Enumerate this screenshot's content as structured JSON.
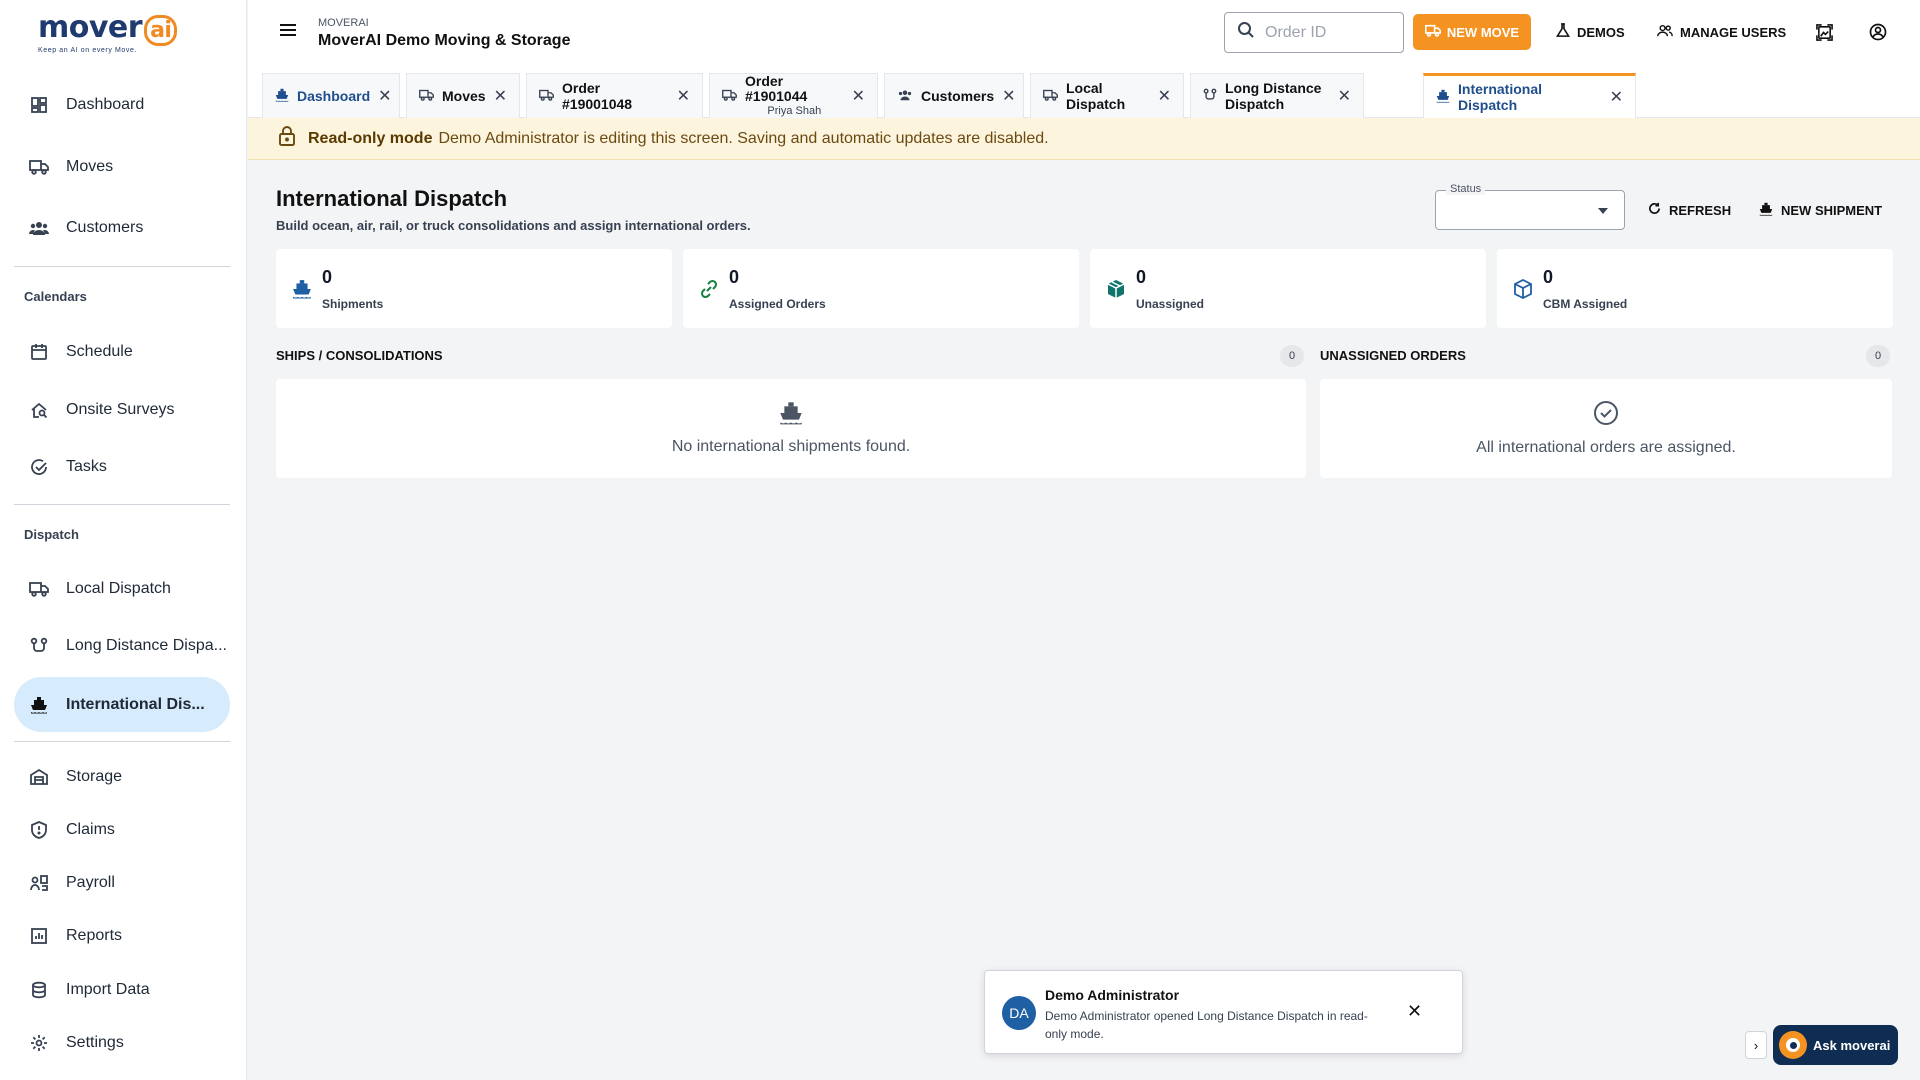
{
  "brand": {
    "logo_word": "mover",
    "logo_ai": "ai",
    "tagline": "Keep an AI on every Move."
  },
  "sidebar": {
    "items": [
      {
        "label": "Dashboard",
        "icon": "dashboard-icon"
      },
      {
        "label": "Moves",
        "icon": "truck-icon"
      },
      {
        "label": "Customers",
        "icon": "people-icon"
      },
      {
        "label": "Schedule",
        "icon": "calendar-icon"
      },
      {
        "label": "Onsite Surveys",
        "icon": "home-search-icon"
      },
      {
        "label": "Tasks",
        "icon": "check-circle-icon"
      },
      {
        "label": "Local Dispatch",
        "icon": "truck-icon"
      },
      {
        "label": "Long Distance Dispa...",
        "icon": "route-icon"
      },
      {
        "label": "International Dis...",
        "icon": "ship-icon",
        "active": true
      },
      {
        "label": "Storage",
        "icon": "warehouse-icon"
      },
      {
        "label": "Claims",
        "icon": "shield-icon"
      },
      {
        "label": "Payroll",
        "icon": "payroll-icon"
      },
      {
        "label": "Reports",
        "icon": "chart-icon"
      },
      {
        "label": "Import Data",
        "icon": "database-icon"
      },
      {
        "label": "Settings",
        "icon": "gear-icon"
      }
    ],
    "sections": {
      "calendars": "Calendars",
      "dispatch": "Dispatch"
    }
  },
  "header": {
    "company_small": "MOVERAI",
    "company_name": "MoverAI Demo Moving & Storage",
    "search_placeholder": "Order ID",
    "new_move": "NEW MOVE",
    "demos": "DEMOS",
    "manage_users": "MANAGE USERS"
  },
  "tabs": [
    {
      "label": "Dashboard",
      "icon": "ship-icon"
    },
    {
      "label": "Moves",
      "icon": "truck-icon"
    },
    {
      "label": "Order #19001048",
      "icon": "truck-icon"
    },
    {
      "label": "Order #1901044",
      "sub": "Priya Shah",
      "icon": "truck-icon"
    },
    {
      "label": "Customers",
      "icon": "people-icon"
    },
    {
      "label": "Local Dispatch",
      "icon": "truck-icon"
    },
    {
      "label": "Long Distance Dispatch",
      "icon": "route-icon"
    },
    {
      "label": "International Dispatch",
      "icon": "ship-icon",
      "active": true
    }
  ],
  "banner": {
    "strong": "Read-only mode",
    "text": "Demo Administrator is editing this screen. Saving and automatic updates are disabled."
  },
  "main": {
    "title": "International Dispatch",
    "subtitle": "Build ocean, air, rail, or truck consolidations and assign international orders.",
    "status_label": "Status",
    "status_value": "",
    "refresh": "REFRESH",
    "new_shipment": "NEW SHIPMENT",
    "stats": [
      {
        "value": "0",
        "label": "Shipments",
        "icon": "ship-icon"
      },
      {
        "value": "0",
        "label": "Assigned Orders",
        "icon": "link-icon"
      },
      {
        "value": "0",
        "label": "Unassigned",
        "icon": "box-icon"
      },
      {
        "value": "0",
        "label": "CBM Assigned",
        "icon": "cube-icon"
      }
    ],
    "ships_title": "SHIPS / CONSOLIDATIONS",
    "ships_count": "0",
    "ships_empty": "No international shipments found.",
    "unassigned_title": "UNASSIGNED ORDERS",
    "unassigned_count": "0",
    "unassigned_empty": "All international orders are assigned."
  },
  "toast": {
    "initials": "DA",
    "title": "Demo Administrator",
    "message": "Demo Administrator opened Long Distance Dispatch in read-only mode."
  },
  "assistant": {
    "label": "Ask moverai",
    "toggle": "›"
  },
  "colors": {
    "accent": "#f59322",
    "active_nav": "#d6ebfb",
    "banner_bg": "#fdf4dd",
    "brand_navy": "#0f2d52"
  }
}
